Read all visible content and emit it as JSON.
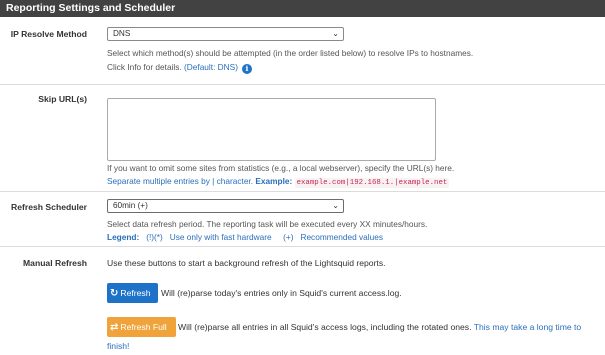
{
  "panel": {
    "title": "Reporting Settings and Scheduler"
  },
  "ip_resolve": {
    "label": "IP Resolve Method",
    "value": "DNS",
    "help_line1": "Select which method(s) should be attempted (in the order listed below) to resolve IPs to hostnames.",
    "help_line2_prefix": "Click Info for details. ",
    "help_line2_default": "(Default: DNS)",
    "info_icon": "info-circle"
  },
  "skip_urls": {
    "label": "Skip URL(s)",
    "value": "",
    "help_line1": "If you want to omit some sites from statistics (e.g., a local webserver), specify the URL(s) here.",
    "help_line2_text": "Separate multiple entries by | character. ",
    "help_line2_example_label": "Example:",
    "help_line2_example_code": "example.com|192.168.1.|example.net"
  },
  "refresh_scheduler": {
    "label": "Refresh Scheduler",
    "value": "60min (+)",
    "help_line1": "Select data refresh period. The reporting task will be executed every XX minutes/hours.",
    "legend_label": "Legend:",
    "legend_item1_sym": "(!)(*)",
    "legend_item1_text": "Use only with fast hardware",
    "legend_item2_sym": "(+)",
    "legend_item2_text": "Recommended values"
  },
  "manual_refresh": {
    "label": "Manual Refresh",
    "description": "Use these buttons to start a background refresh of the Lightsquid reports.",
    "refresh_button": "Refresh",
    "refresh_text": "Will (re)parse today's entries only in Squid's current access.log.",
    "refresh_full_button": "Refresh Full",
    "refresh_full_text": "Will (re)parse all entries in all Squid's access logs, including the rotated ones. ",
    "refresh_full_warning_a": "This may take a long time to",
    "refresh_full_warning_b": "finish!"
  },
  "colors": {
    "header_bg": "#424242",
    "primary": "#1e73c8",
    "warning": "#f0a33a",
    "link": "#2a6ebb"
  }
}
